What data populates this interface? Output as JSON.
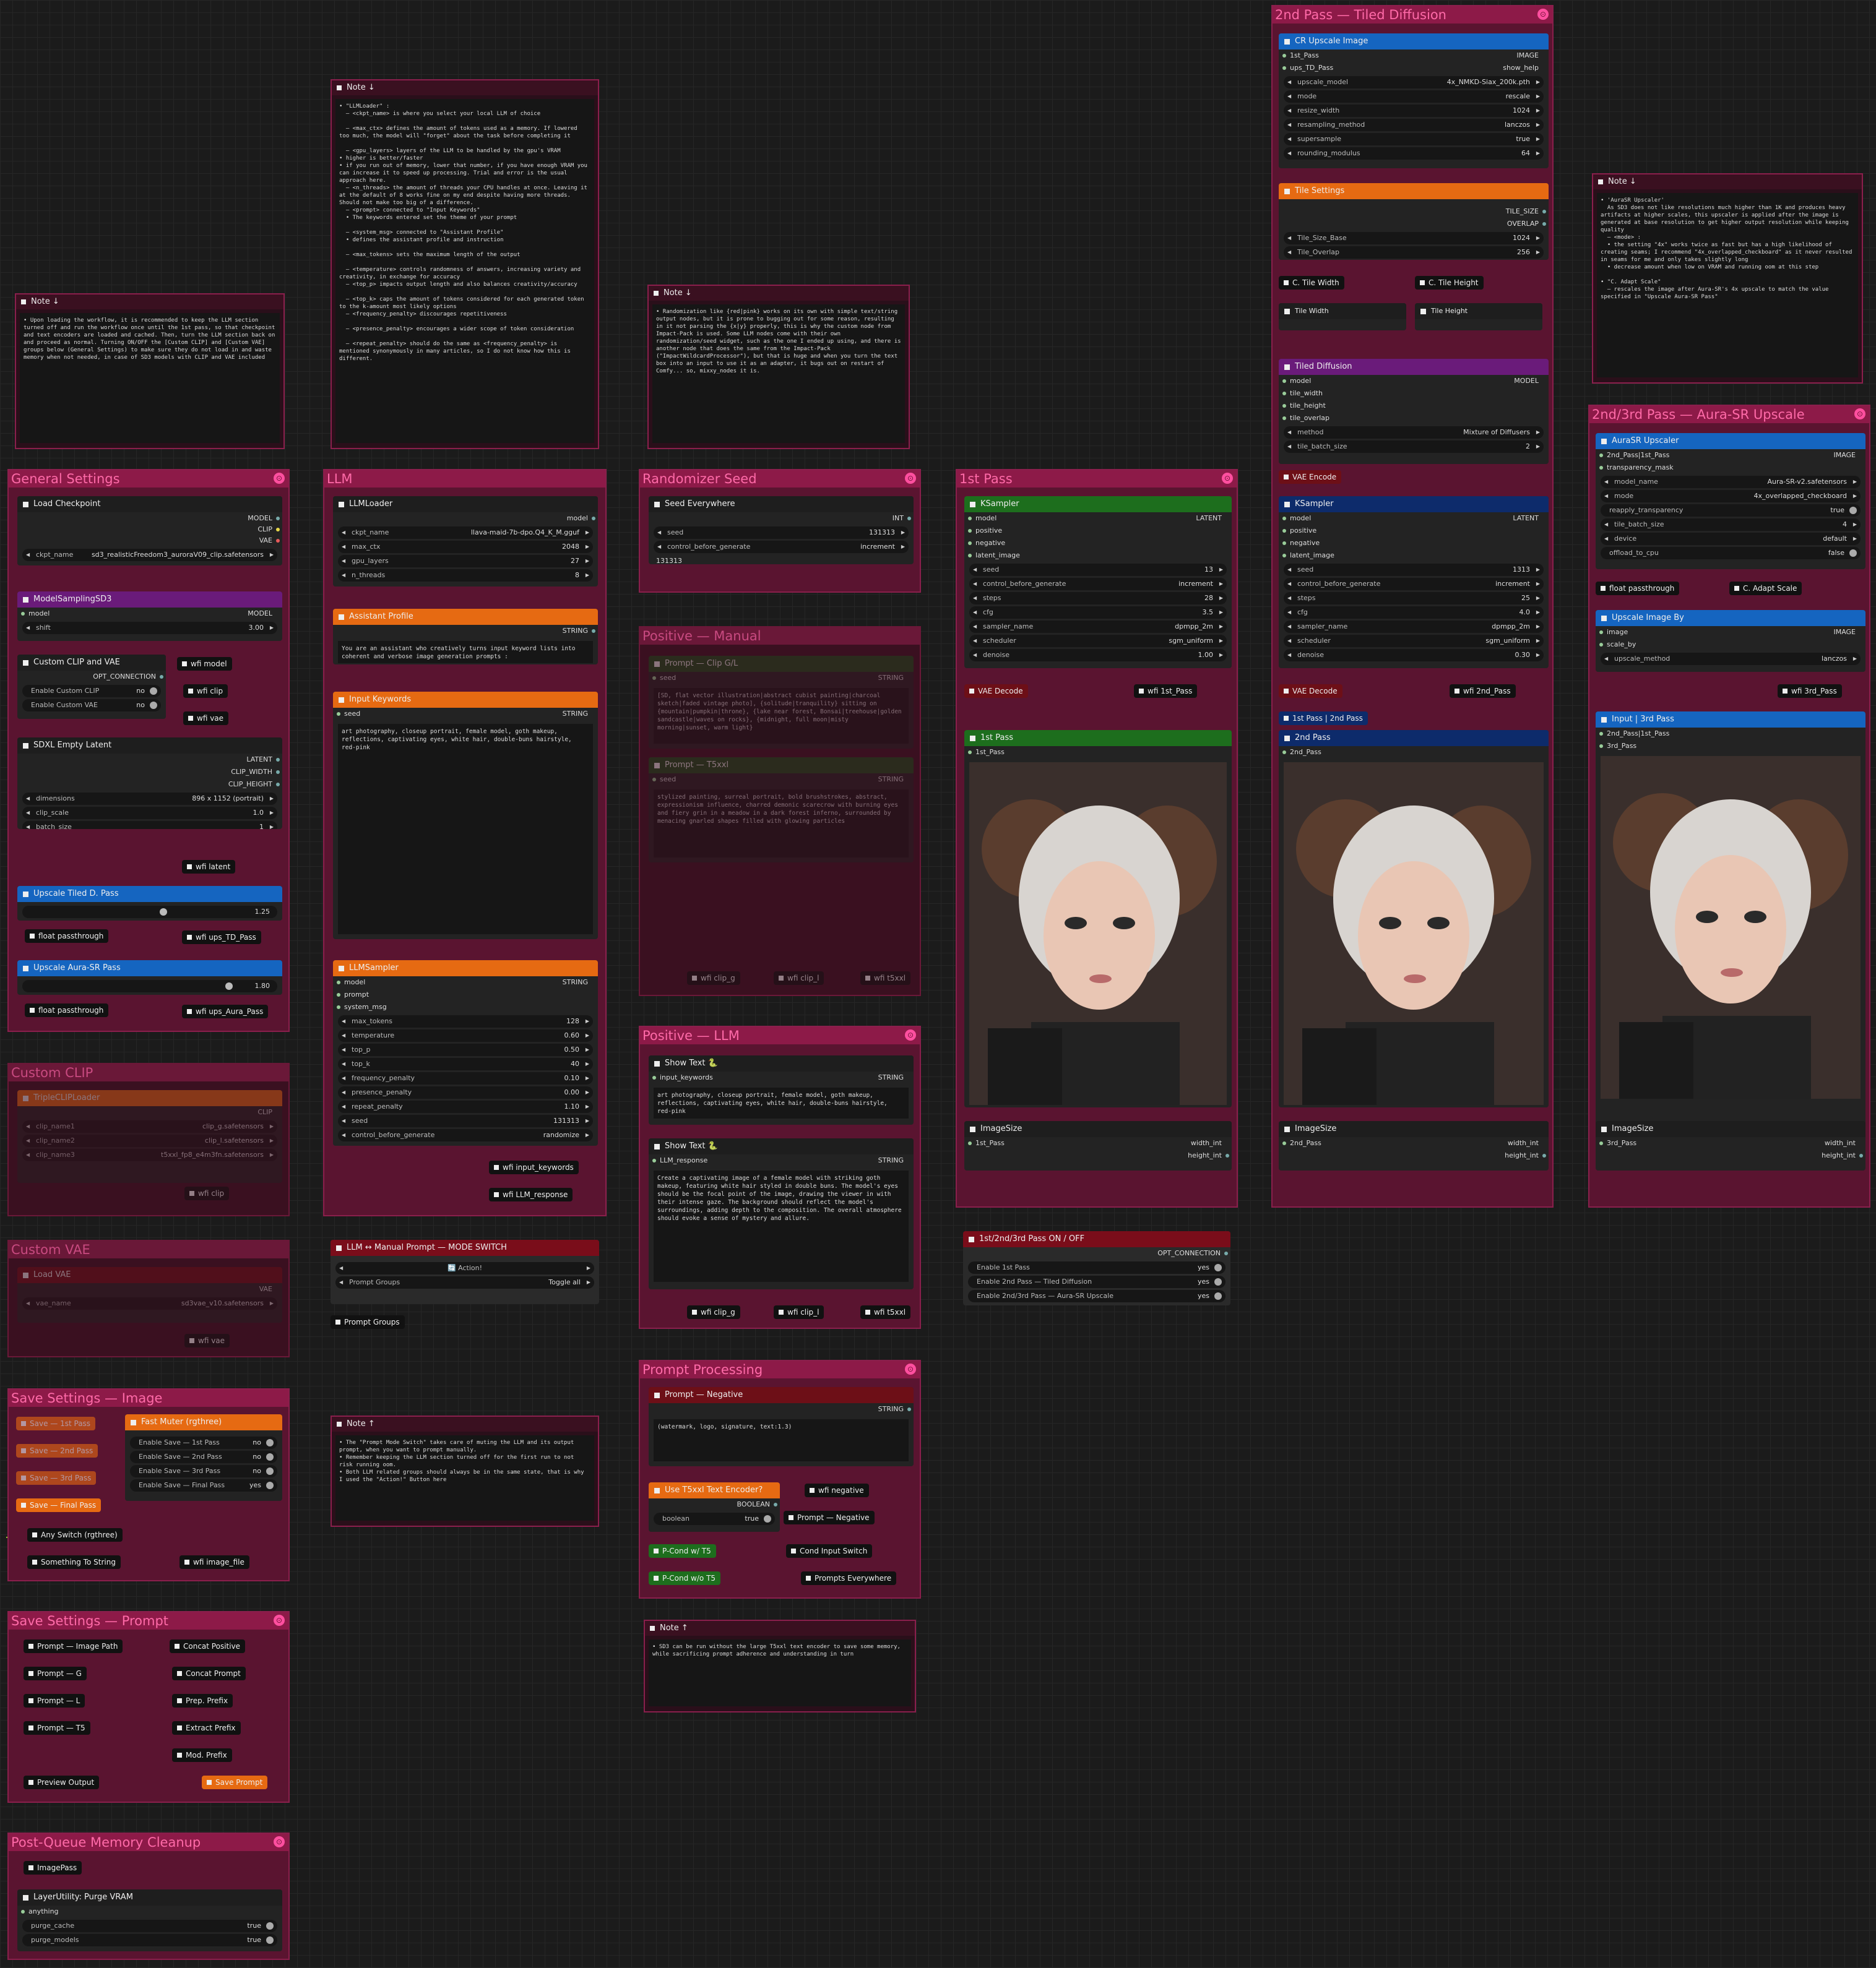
{
  "groups": {
    "general": "General Settings",
    "llm": "LLM",
    "seed": "Randomizer Seed",
    "first": "1st Pass",
    "second": "2nd Pass — Tiled Diffusion",
    "aura": "2nd/3rd Pass — Aura-SR Upscale",
    "posmanual": "Positive — Manual",
    "posllm": "Positive — LLM",
    "clip": "Custom CLIP",
    "vae": "Custom VAE",
    "saveimg": "Save Settings — Image",
    "saveprompt": "Save Settings — Prompt",
    "promptproc": "Prompt Processing",
    "cleanup": "Post-Queue Memory Cleanup"
  },
  "notes": {
    "n1": {
      "title": "Note ↓",
      "body": "• Upon loading the workflow, it is recommended to keep the LLM section turned off and run the workflow once until the 1st pass, so that checkpoint and text encoders are loaded and cached. Then, turn the LLM section back on and proceed as normal. Turning ON/OFF the [Custom CLIP] and [Custom VAE] groups below (General Settings) to make sure they do not load in and waste memory when not needed, in case of SD3 models with CLIP and VAE included"
    },
    "n2": {
      "title": "Note ↓",
      "body": "• \"LLMLoader\" :\n  – <ckpt_name> is where you select your local LLM of choice\n\n  – <max_ctx> defines the amount of tokens used as a memory. If lowered too much, the model will \"forget\" about the task before completing it\n\n  – <gpu_layers> layers of the LLM to be handled by the gpu's VRAM\n• higher is better/faster\n• if you run out of memory, lower that number, if you have enough VRAM you can increase it to speed up processing. Trial and error is the usual approach here.\n  – <n_threads> the amount of threads your CPU handles at once. Leaving it at the default of 8 works fine on my end despite having more threads. Should not make too big of a difference.\n  – <prompt> connected to \"Input Keywords\"\n  • The keywords entered set the theme of your prompt\n\n  – <system_msg> connected to \"Assistant Profile\"\n  • defines the assistant profile and instruction\n\n  – <max_tokens> sets the maximum length of the output\n\n  – <temperature> controls randomness of answers, increasing variety and creativity, in exchange for accuracy\n  – <top_p> impacts output length and also balances creativity/accuracy\n\n  – <top_k> caps the amount of tokens considered for each generated token to the k-amount most likely options\n  – <frequency_penalty> discourages repetitiveness\n\n  – <presence_penalty> encourages a wider scope of token consideration\n\n  – <repeat_penalty> should do the same as <frequency_penalty> is mentioned synonymously in many articles, so I do not know how this is different."
    },
    "n3": {
      "title": "Note ↓",
      "body": "• Randomization like {red|pink} works on its own with simple text/string output nodes, but it is prone to bugging out for some reason, resulting in it not parsing the {x|y} properly, this is why the custom node from Impact-Pack is used. Some LLM nodes come with their own randomization/seed widget, such as the one I ended up using, and there is another node that does the same from the Impact-Pack (\"ImpactWildcardProcessor\"), but that is huge and when you turn the text box into an input to use it as an adapter, it bugs out on restart of Comfy... so, mixxy_nodes it is."
    },
    "n4": {
      "title": "Note ↓",
      "body": "• 'AuraSR Upscaler'\n  As SD3 does not like resolutions much higher than 1K and produces heavy artifacts at higher scales, this upscaler is applied after the image is generated at base resolution to get higher output resolution while keeping quality\n  – <mode> :\n  • the setting \"4x\" works twice as fast but has a high likelihood of creating seams; I recommend \"4x_overlapped_checkboard\" as it never resulted in seams for me and only takes slightly long\n  • decrease amount when low on VRAM and running oom at this step\n\n• \"C. Adapt Scale\"\n  – rescales the image after Aura-SR's 4x upscale to match the value specified in \"Upscale Aura-SR Pass\""
    },
    "n5": {
      "title": "Note ↑",
      "body": "• The \"Prompt Mode Switch\" takes care of muting the LLM and its output prompt, when you want to prompt manually.\n• Remember keeping the LLM section turned off for the first run to not risk running oom.\n• Both LLM related groups should always be in the same state, that is why I used the \"Action!\" Button here"
    },
    "n6": {
      "title": "Note ↑",
      "body": "• SD3 can be run without the large T5xxl text encoder to save some memory, while sacrificing prompt adherence and understanding in turn"
    }
  },
  "general": {
    "load_ckpt": "Load Checkpoint",
    "out_model": "MODEL",
    "out_clip": "CLIP",
    "out_vae": "VAE",
    "ckpt_key": "ckpt_name",
    "ckpt_val": "sd3_realisticFreedom3_auroraV09_clip.safetensors",
    "msd3": "ModelSamplingSD3",
    "model_in": "model",
    "model_out": "MODEL",
    "shift_k": "shift",
    "shift_v": "3.00",
    "cclip": "Custom CLIP and VAE",
    "opt": "OPT_CONNECTION",
    "en_clip": "Enable Custom CLIP",
    "en_clip_v": "no",
    "en_vae": "Enable Custom VAE",
    "en_vae_v": "no",
    "wfi_model": "wfi model",
    "wfi_clip": "wfi clip",
    "wfi_vae": "wfi vae",
    "latent": "SDXL Empty Latent",
    "lat_out": "LATENT",
    "cw": "CLIP_WIDTH",
    "ch": "CLIP_HEIGHT",
    "dim_k": "dimensions",
    "dim_v": "896 x 1152  (portrait)",
    "cs_k": "clip_scale",
    "cs_v": "1.0",
    "bs_k": "batch_size",
    "bs_v": "1",
    "wfi_latent": "wfi latent",
    "up_td": "Upscale Tiled D. Pass",
    "up_td_v": "1.25",
    "float1": "float passthrough",
    "wfi_up_td": "wfi ups_TD_Pass",
    "up_aura": "Upscale Aura-SR Pass",
    "up_aura_v": "1.80",
    "float2": "float passthrough",
    "wfi_up_aura": "wfi ups_Aura_Pass"
  },
  "clipg": {
    "node": "TripleCLIPLoader",
    "out": "CLIP",
    "c1k": "clip_name1",
    "c1v": "clip_g.safetensors",
    "c2k": "clip_name2",
    "c2v": "clip_l.safetensors",
    "c3k": "clip_name3",
    "c3v": "t5xxl_fp8_e4m3fn.safetensors",
    "wfi": "wfi clip"
  },
  "vaeg": {
    "node": "Load VAE",
    "out": "VAE",
    "k": "vae_name",
    "v": "sd3vae_v10.safetensors",
    "wfi": "wfi vae"
  },
  "llm": {
    "loader": "LLMLoader",
    "model_out": "model",
    "ckpt_k": "ckpt_name",
    "ckpt_v": "llava-maid-7b-dpo.Q4_K_M.gguf",
    "ctx_k": "max_ctx",
    "ctx_v": "2048",
    "gpu_k": "gpu_layers",
    "gpu_v": "27",
    "thr_k": "n_threads",
    "thr_v": "8",
    "profile": "Assistant Profile",
    "string": "STRING",
    "profile_text": "You are an assistant who creatively turns input keyword lists into coherent and verbose image generation prompts :",
    "keywords": "Input Keywords",
    "seed_in": "seed",
    "kw_text": "art photography, closeup portrait, female model, goth makeup, reflections, captivating eyes, white hair, double-buns hairstyle, red-pink",
    "sampler": "LLMSampler",
    "in_model": "model",
    "in_prompt": "prompt",
    "in_sys": "system_msg",
    "mt_k": "max_tokens",
    "mt_v": "128",
    "t_k": "temperature",
    "t_v": "0.60",
    "tp_k": "top_p",
    "tp_v": "0.50",
    "tk_k": "top_k",
    "tk_v": "40",
    "fp_k": "frequency_penalty",
    "fp_v": "0.10",
    "pp_k": "presence_penalty",
    "pp_v": "0.00",
    "rp_k": "repeat_penalty",
    "rp_v": "1.10",
    "sd_k": "seed",
    "sd_v": "131313",
    "cbg_k": "control_before_generate",
    "cbg_v": "randomize",
    "wfi_kw": "wfi input_keywords",
    "wfi_resp": "wfi LLM_response"
  },
  "seed": {
    "node": "Seed Everywhere",
    "int": "INT",
    "seed_k": "seed",
    "seed_v": "131313",
    "cbg_k": "control_before_generate",
    "cbg_v": "increment",
    "disp": "131313"
  },
  "posmanual": {
    "p1": "Prompt — Clip G/L",
    "p1_text": "[SD, flat vector illustration|abstract cubist painting|charcoal sketch|faded vintage photo], {solitude|tranquility} sitting on {mountain|pumpkin|throne}, {lake near forest, Bonsai|treehouse|golden sandcastle|waves on rocks}, {midnight, full moon|misty morning|sunset, warm light}",
    "p2": "Prompt — T5xxl",
    "p2_text": "stylized painting, surreal portrait, bold brushstrokes, abstract, expressionism influence, charred demonic scarecrow with burning eyes and fiery grin in a meadow in a dark forest inferno, surrounded by menacing gnarled shapes filled with glowing particles",
    "string": "STRING",
    "seed": "seed",
    "w1": "wfi clip_g",
    "w2": "wfi clip_l",
    "w3": "wfi t5xxl"
  },
  "posllm": {
    "st1": "Show Text 🐍",
    "in1": "input_keywords",
    "string": "STRING",
    "t1": "art photography, closeup portrait, female model, goth makeup, reflections, captivating eyes, white hair, double-buns hairstyle, red-pink",
    "st2": "Show Text 🐍",
    "in2": "LLM_response",
    "t2": "Create a captivating image of a female model with striking goth makeup, featuring white hair styled in double buns. The model's eyes should be the focal point of the image, drawing the viewer in with their intense gaze. The background should reflect the model's surroundings, adding depth to the composition. The overall atmosphere should evoke a sense of mystery and allure.",
    "w1": "wfi clip_g",
    "w2": "wfi clip_l",
    "w3": "wfi t5xxl"
  },
  "mode": {
    "node": "LLM ↔ Manual Prompt — MODE SWITCH",
    "action": "🔄 Action!",
    "pg_k": "Prompt Groups",
    "pg_v": "Toggle all",
    "pg2": "Prompt Groups"
  },
  "first": {
    "ks": "KSampler",
    "latent": "LATENT",
    "model": "model",
    "positive": "positive",
    "negative": "negative",
    "latent_image": "latent_image",
    "seed_k": "seed",
    "seed_v": "13",
    "cbg_k": "control_before_generate",
    "cbg_v": "increment",
    "steps_k": "steps",
    "steps_v": "28",
    "cfg_k": "cfg",
    "cfg_v": "3.5",
    "sn_k": "sampler_name",
    "sn_v": "dpmpp_2m",
    "sch_k": "scheduler",
    "sch_v": "sgm_uniform",
    "dn_k": "denoise",
    "dn_v": "1.00",
    "vae": "VAE Decode",
    "wfi": "wfi 1st_Pass",
    "prev": "1st Pass",
    "prev_in": "1st_Pass",
    "isz": "ImageSize",
    "isz_in": "1st_Pass",
    "wi": "width_int",
    "hi": "height_int"
  },
  "onoff": {
    "node": "1st/2nd/3rd Pass ON / OFF",
    "opt": "OPT_CONNECTION",
    "e1": "Enable 1st Pass",
    "e2": "Enable 2nd Pass — Tiled Diffusion",
    "e3": "Enable 2nd/3rd Pass — Aura-SR Upscale",
    "yes": "yes"
  },
  "second": {
    "cr": "CR Upscale Image",
    "in1": "1st_Pass",
    "in2": "ups_TD_Pass",
    "image": "IMAGE",
    "help": "show_help",
    "um_k": "upscale_model",
    "um_v": "4x_NMKD-Siax_200k.pth",
    "mode_k": "mode",
    "mode_v": "rescale",
    "rw_k": "resize_width",
    "rw_v": "1024",
    "rm_k": "resampling_method",
    "rm_v": "lanczos",
    "ss_k": "supersample",
    "ss_v": "true",
    "rmod_k": "rounding_modulus",
    "rmod_v": "64",
    "tile": "Tile Settings",
    "tsize": "TILE_SIZE",
    "overlap": "OVERLAP",
    "tsb_k": "Tile_Size_Base",
    "tsb_v": "1024",
    "to_k": "Tile_Overlap",
    "to_v": "256",
    "ctw": "C. Tile Width",
    "cth": "C. Tile Height",
    "tw": "Tile Width",
    "th": "Tile Height",
    "td": "Tiled Diffusion",
    "model": "model",
    "MODEL": "MODEL",
    "tw_in": "tile_width",
    "th_in": "tile_height",
    "to_in": "tile_overlap",
    "meth_k": "method",
    "meth_v": "Mixture of Diffusers",
    "tbs_k": "tile_batch_size",
    "tbs_v": "2",
    "venc": "VAE Encode",
    "ks": "KSampler",
    "latent": "LATENT",
    "positive": "positive",
    "negative": "negative",
    "latent_image": "latent_image",
    "seed_k": "seed",
    "seed_v": "1313",
    "cbg_k": "control_before_generate",
    "cbg_v": "increment",
    "steps_k": "steps",
    "steps_v": "25",
    "cfg_k": "cfg",
    "cfg_v": "4.0",
    "sn_k": "sampler_name",
    "sn_v": "dpmpp_2m",
    "sch_k": "scheduler",
    "sch_v": "sgm_uniform",
    "dn_k": "denoise",
    "dn_v": "0.30",
    "vae": "VAE Decode",
    "wfi": "wfi 2nd_Pass",
    "sw": "1st Pass | 2nd Pass",
    "prev": "2nd Pass",
    "prev_in": "2nd_Pass",
    "isz": "ImageSize",
    "isz_in": "2nd_Pass",
    "wi": "width_int",
    "hi": "height_int"
  },
  "aura": {
    "up": "AuraSR Upscaler",
    "in1": "2nd_Pass|1st_Pass",
    "in2": "transparency_mask",
    "image": "IMAGE",
    "mn_k": "model_name",
    "mn_v": "Aura-SR-v2.safetensors",
    "mode_k": "mode",
    "mode_v": "4x_overlapped_checkboard",
    "rt_k": "reapply_transparency",
    "rt_v": "true",
    "tbs_k": "tile_batch_size",
    "tbs_v": "4",
    "dev_k": "device",
    "dev_v": "default",
    "off_k": "offload_to_cpu",
    "off_v": "false",
    "fp": "float passthrough",
    "cas": "C. Adapt Scale",
    "ub": "Upscale Image By",
    "ub_in1": "image",
    "ub_in2": "scale_by",
    "ub_out": "IMAGE",
    "um_k": "upscale_method",
    "um_v": "lanczos",
    "wfi": "wfi 3rd_Pass",
    "inp": "Input | 3rd Pass",
    "inp1": "2nd_Pass|1st_Pass",
    "inp2": "3rd_Pass",
    "isz": "ImageSize",
    "isz_in": "3rd_Pass",
    "wi": "width_int",
    "hi": "height_int"
  },
  "saveimg": {
    "s1": "Save — 1st Pass",
    "s2": "Save — 2nd Pass",
    "s3": "Save — 3rd Pass",
    "s4": "Save — Final Pass",
    "fm": "Fast Muter (rgthree)",
    "e1": "Enable Save — 1st Pass",
    "e2": "Enable Save — 2nd Pass",
    "e3": "Enable Save — 3rd Pass",
    "e4": "Enable Save — Final Pass",
    "no": "no",
    "yes": "yes",
    "any": "Any Switch (rgthree)",
    "sts": "Something To String",
    "wfi": "wfi image_file"
  },
  "saveprompt": {
    "p1": "Prompt — Image Path",
    "p2": "Prompt — G",
    "p3": "Prompt — L",
    "p4": "Prompt — T5",
    "c1": "Concat Positive",
    "c2": "Concat Prompt",
    "c3": "Prep. Prefix",
    "c4": "Extract Prefix",
    "c5": "Mod. Prefix",
    "prev": "Preview Output",
    "save": "Save Prompt"
  },
  "promptproc": {
    "neg": "Prompt — Negative",
    "string": "STRING",
    "neg_text": "(watermark, logo, signature, text:1.3)",
    "use": "Use T5xxl Text Encoder?",
    "bool": "BOOLEAN",
    "bk": "boolean",
    "bv": "true",
    "wfi": "wfi negative",
    "pneg": "Prompt — Negative",
    "p1": "P-Cond w/ T5",
    "p2": "P-Cond w/o T5",
    "cis": "Cond Input Switch",
    "pe": "Prompts Everywhere"
  },
  "cleanup": {
    "ip": "ImagePass",
    "purge": "LayerUtility: Purge VRAM",
    "any": "anything",
    "pc_k": "purge_cache",
    "pc_v": "true",
    "pm_k": "purge_models",
    "pm_v": "true"
  },
  "colors": {
    "group_bg": "#5a1430",
    "group_title": "#8d1a48",
    "title_text": "#ff6aa8"
  }
}
